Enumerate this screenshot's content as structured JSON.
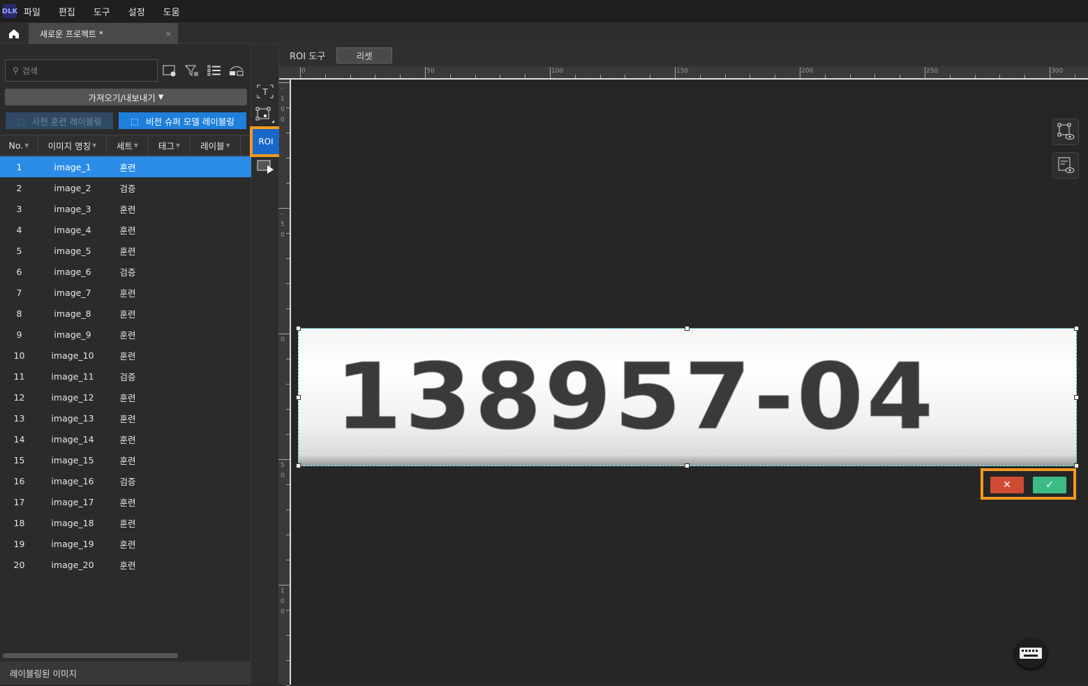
{
  "app": {
    "logo": "DLK",
    "menu": [
      "파일",
      "편집",
      "도구",
      "설정",
      "도움"
    ],
    "tab_title": "새로운 프로젝트 *",
    "tab_close": "×"
  },
  "left": {
    "search_placeholder": "검색",
    "import_export": "가져오기/내보내기",
    "pretrained_labeling": "사전 훈련 레이블링",
    "vision_super_labeling": "비전 슈퍼 모델 레이블링",
    "columns": [
      "No.",
      "이미지 명칭",
      "세트",
      "태그",
      "레이블"
    ],
    "rows": [
      {
        "no": "1",
        "name": "image_1",
        "set": "훈련"
      },
      {
        "no": "2",
        "name": "image_2",
        "set": "검증"
      },
      {
        "no": "3",
        "name": "image_3",
        "set": "훈련"
      },
      {
        "no": "4",
        "name": "image_4",
        "set": "훈련"
      },
      {
        "no": "5",
        "name": "image_5",
        "set": "훈련"
      },
      {
        "no": "6",
        "name": "image_6",
        "set": "검증"
      },
      {
        "no": "7",
        "name": "image_7",
        "set": "훈련"
      },
      {
        "no": "8",
        "name": "image_8",
        "set": "훈련"
      },
      {
        "no": "9",
        "name": "image_9",
        "set": "훈련"
      },
      {
        "no": "10",
        "name": "image_10",
        "set": "훈련"
      },
      {
        "no": "11",
        "name": "image_11",
        "set": "검증"
      },
      {
        "no": "12",
        "name": "image_12",
        "set": "훈련"
      },
      {
        "no": "13",
        "name": "image_13",
        "set": "훈련"
      },
      {
        "no": "14",
        "name": "image_14",
        "set": "훈련"
      },
      {
        "no": "15",
        "name": "image_15",
        "set": "훈련"
      },
      {
        "no": "16",
        "name": "image_16",
        "set": "검증"
      },
      {
        "no": "17",
        "name": "image_17",
        "set": "훈련"
      },
      {
        "no": "18",
        "name": "image_18",
        "set": "훈련"
      },
      {
        "no": "19",
        "name": "image_19",
        "set": "훈련"
      },
      {
        "no": "20",
        "name": "image_20",
        "set": "훈련"
      }
    ],
    "selected_row": "1",
    "footer": "레이블링된 이미지"
  },
  "tools": {
    "text_tool": "T",
    "roi_tool": "ROI"
  },
  "roi_bar": {
    "title": "ROI 도구",
    "reset": "리셋"
  },
  "rulers": {
    "h_labels": [
      "0",
      "50",
      "100",
      "150",
      "200",
      "250",
      "300"
    ],
    "v_labels": [
      "-100",
      "-50",
      "0",
      "50",
      "100"
    ]
  },
  "image": {
    "text": "138957-04"
  },
  "actions": {
    "cancel": "✕",
    "confirm": "✓"
  }
}
